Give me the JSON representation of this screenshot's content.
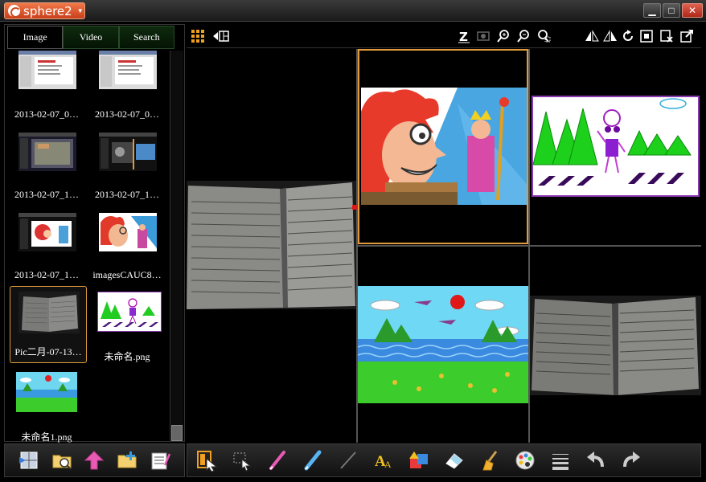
{
  "app": {
    "name": "sphere2"
  },
  "window": {
    "minimize": "▁",
    "maximize": "□",
    "close": "✕"
  },
  "tabs": [
    {
      "label": "Image",
      "active": true
    },
    {
      "label": "Video",
      "active": false
    },
    {
      "label": "Search",
      "active": false
    }
  ],
  "thumbnails": [
    {
      "label": "2013-02-07_0…",
      "kind": "screen-white"
    },
    {
      "label": "2013-02-07_0…",
      "kind": "screen-white"
    },
    {
      "label": "2013-02-07_1…",
      "kind": "screen-dark"
    },
    {
      "label": "2013-02-07_1…",
      "kind": "screen-dark2"
    },
    {
      "label": "2013-02-07_1…",
      "kind": "screen-cartoon"
    },
    {
      "label": "imagesCAUC8…",
      "kind": "cartoon"
    },
    {
      "label": "Pic二月-07-13…",
      "kind": "notebook",
      "selected": true
    },
    {
      "label": "未命名.png",
      "kind": "drawing"
    },
    {
      "label": "未命名1.png",
      "kind": "landscape"
    }
  ],
  "colors": {
    "accent": "#e09a3c",
    "titlebar_button": "#d85a2e",
    "tab_inactive": "#0e2a0e"
  },
  "left_toolbar_icons": [
    "import-icon",
    "open-folder-icon",
    "upload-icon",
    "new-folder-icon",
    "edit-list-icon"
  ],
  "main_toolbar_icons": [
    "layout-select-icon",
    "marquee-icon",
    "pen-icon",
    "highlighter-icon",
    "line-icon",
    "text-icon",
    "shape-icon",
    "eraser-icon",
    "clear-icon",
    "palette-icon",
    "line-width-icon",
    "undo-icon",
    "redo-icon"
  ],
  "top_toolbar_icons": [
    "grid-view-icon",
    "back-layout-icon",
    "freeze-icon",
    "capture-icon",
    "zoom-in-icon",
    "zoom-out-icon",
    "zoom-area-icon",
    "flip-h-icon",
    "flip-v-icon",
    "rotate-icon",
    "fit-icon",
    "close-image-icon",
    "export-icon"
  ]
}
